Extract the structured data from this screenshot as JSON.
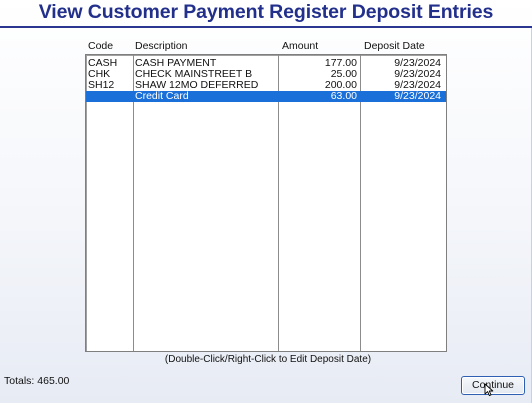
{
  "window": {
    "title": "View Customer Payment Register Deposit Entries"
  },
  "table": {
    "columns": [
      "Code",
      "Description",
      "Amount",
      "Deposit Date"
    ],
    "rows": [
      {
        "code": "CASH",
        "description": "CASH PAYMENT",
        "amount": "177.00",
        "deposit_date": "9/23/2024",
        "selected": false
      },
      {
        "code": "CHK",
        "description": "CHECK MAINSTREET B",
        "amount": "25.00",
        "deposit_date": "9/23/2024",
        "selected": false
      },
      {
        "code": "SH12",
        "description": "SHAW 12MO DEFERRED",
        "amount": "200.00",
        "deposit_date": "9/23/2024",
        "selected": false
      },
      {
        "code": "",
        "description": "Credit Card",
        "amount": "63.00",
        "deposit_date": "9/23/2024",
        "selected": true
      }
    ],
    "hint": "(Double-Click/Right-Click to Edit Deposit Date)"
  },
  "footer": {
    "totals": "Totals: 465.00",
    "continue_label": "Continue"
  },
  "colors": {
    "title": "#22308c",
    "selection": "#1a70d8"
  },
  "icons": {
    "cursor": "mouse-pointer-icon"
  }
}
